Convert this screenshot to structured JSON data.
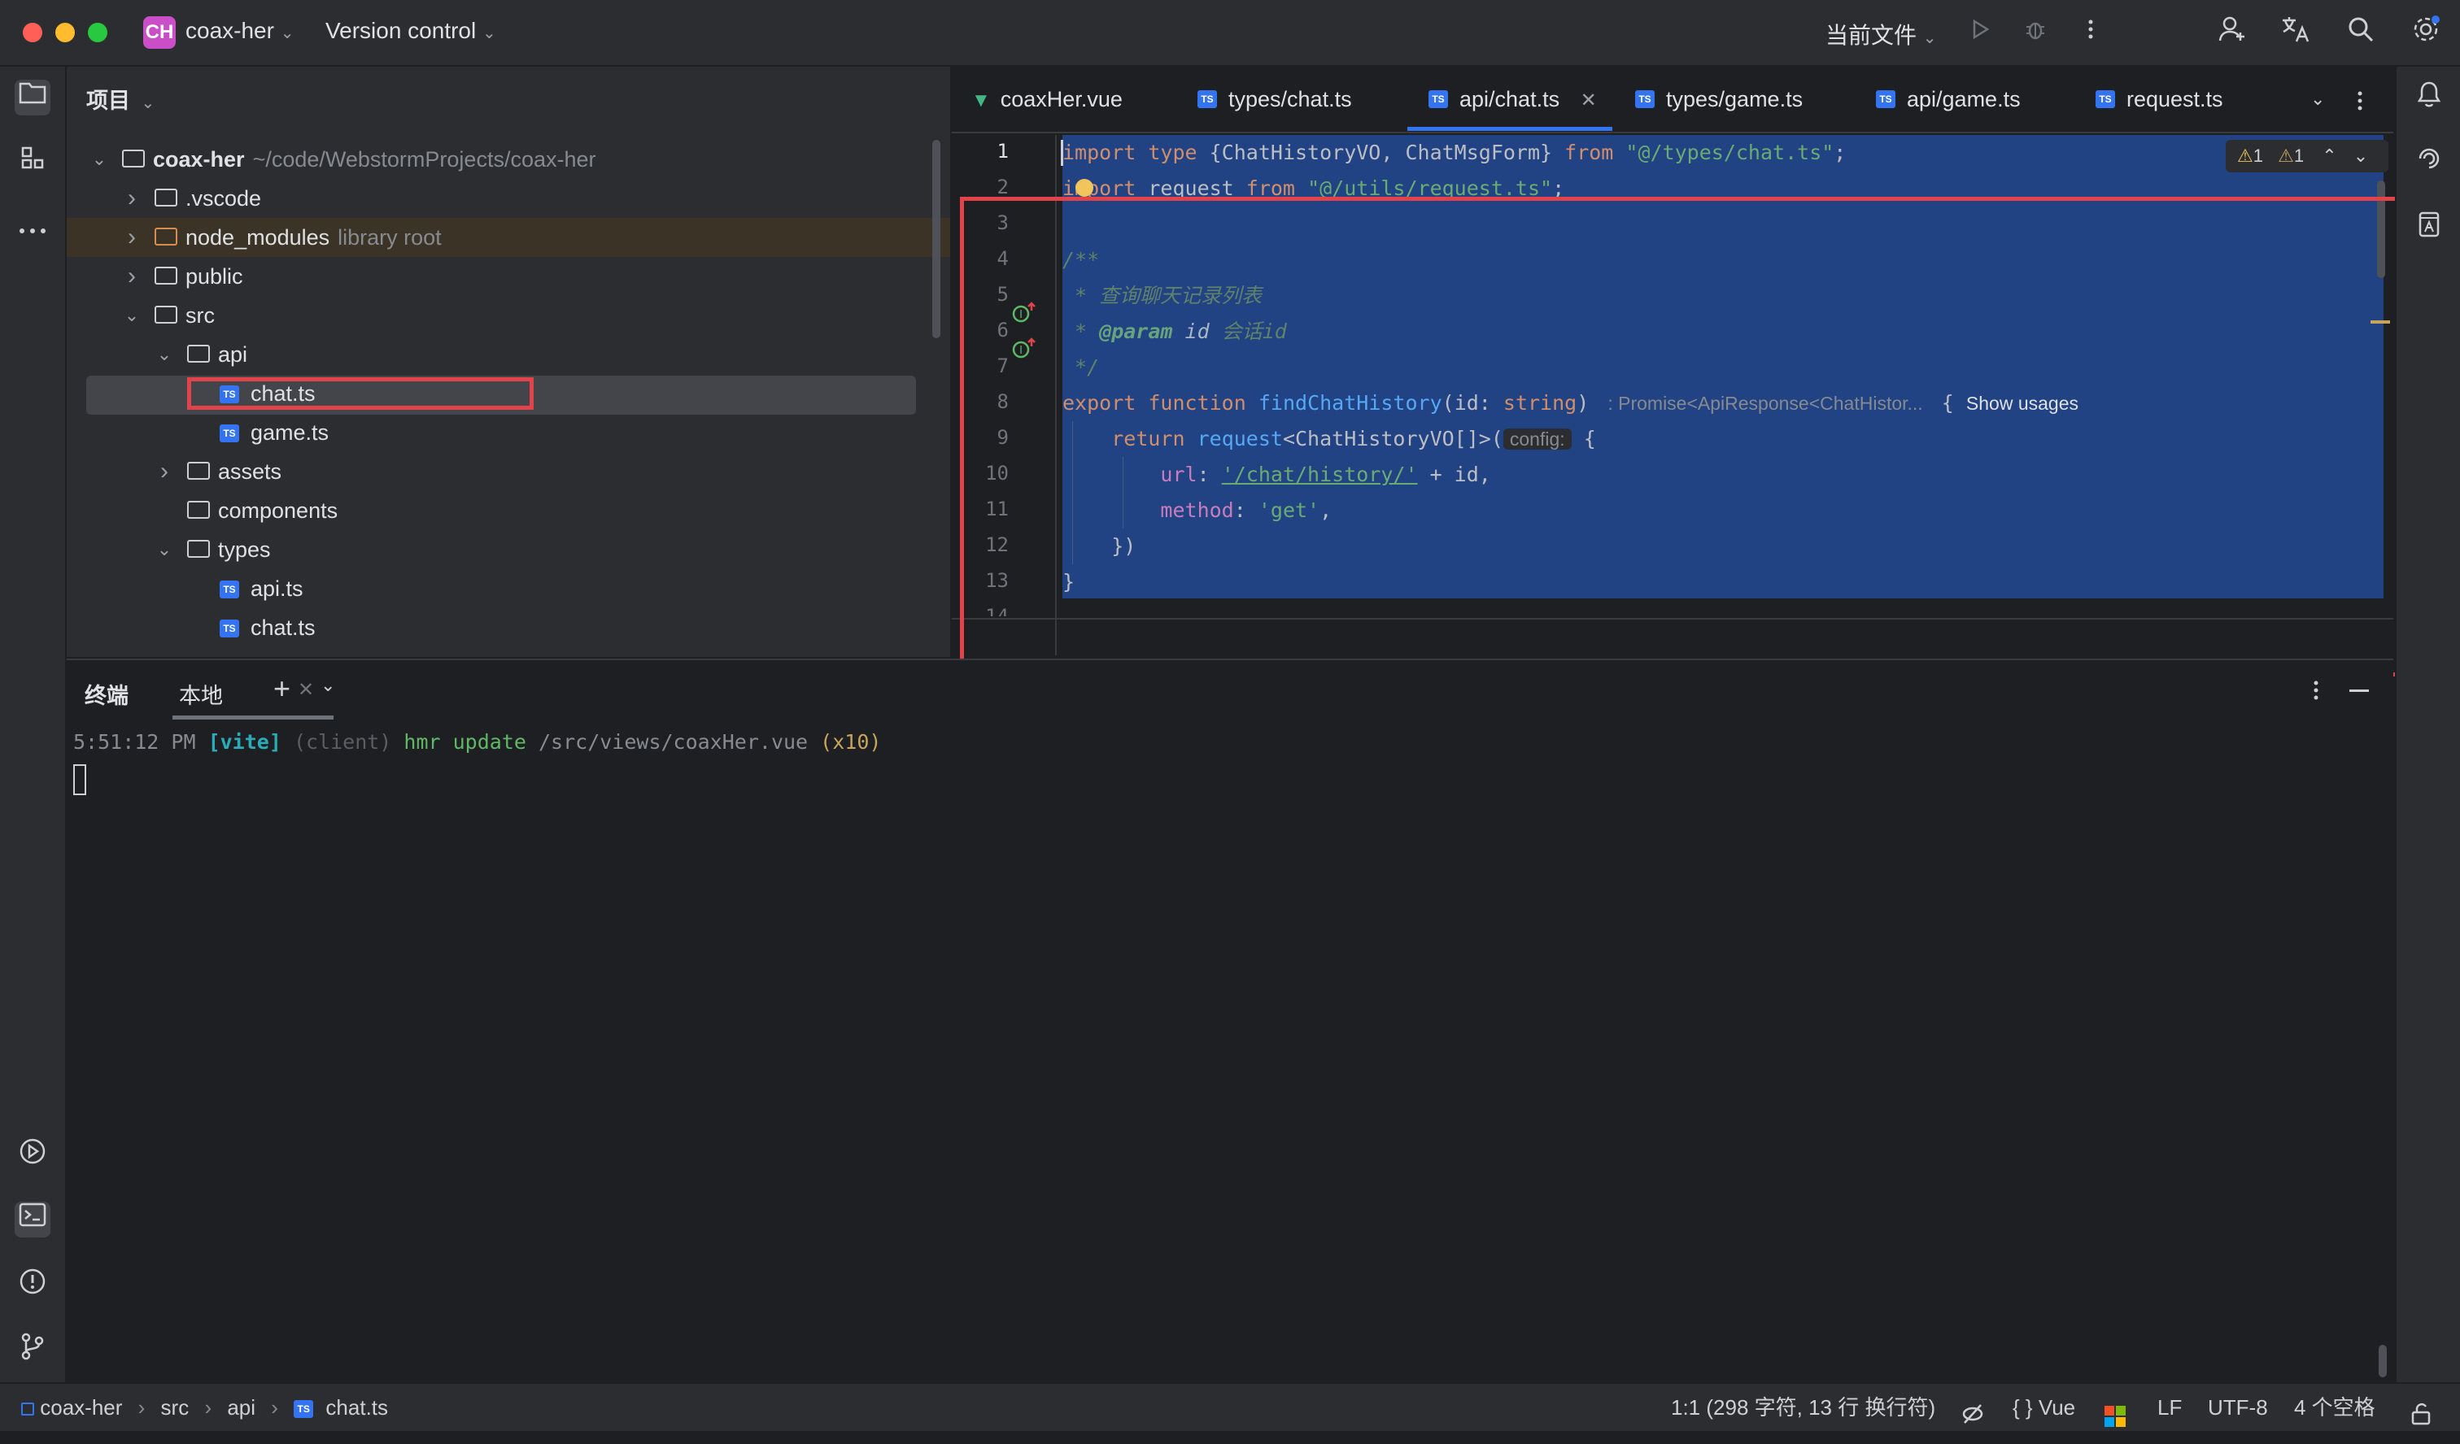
{
  "titlebar": {
    "project_badge": "CH",
    "project_name": "coax-her",
    "version_control": "Version control",
    "run_config": "当前文件",
    "icons": [
      "run-icon",
      "debug-icon",
      "more-icon",
      "add-user-icon",
      "translate-icon",
      "search-icon",
      "settings-icon"
    ]
  },
  "left_strip": {
    "icons": [
      "folder-icon",
      "structure-icon",
      "more-tools-icon",
      "services-icon",
      "terminal-icon",
      "problems-icon",
      "git-icon"
    ]
  },
  "project_panel": {
    "title": "项目",
    "tree": [
      {
        "name": "coax-her",
        "hint": "~/code/WebstormProjects/coax-her",
        "type": "folder",
        "expanded": true
      },
      {
        "name": ".vscode",
        "hint": "",
        "type": "folder",
        "expanded": false
      },
      {
        "name": "node_modules",
        "hint": "library root",
        "type": "folder",
        "expanded": false
      },
      {
        "name": "public",
        "hint": "",
        "type": "folder",
        "expanded": false
      },
      {
        "name": "src",
        "hint": "",
        "type": "folder",
        "expanded": true
      },
      {
        "name": "api",
        "hint": "",
        "type": "folder",
        "expanded": true
      },
      {
        "name": "chat.ts",
        "hint": "",
        "type": "ts",
        "selected": true
      },
      {
        "name": "game.ts",
        "hint": "",
        "type": "ts"
      },
      {
        "name": "assets",
        "hint": "",
        "type": "folder",
        "expanded": false
      },
      {
        "name": "components",
        "hint": "",
        "type": "folder"
      },
      {
        "name": "types",
        "hint": "",
        "type": "folder",
        "expanded": true
      },
      {
        "name": "api.ts",
        "hint": "",
        "type": "ts"
      },
      {
        "name": "chat.ts",
        "hint": "",
        "type": "ts"
      }
    ]
  },
  "editor": {
    "tabs": [
      {
        "label": "coaxHer.vue",
        "kind": "vue"
      },
      {
        "label": "types/chat.ts",
        "kind": "ts"
      },
      {
        "label": "api/chat.ts",
        "kind": "ts",
        "active": true
      },
      {
        "label": "types/game.ts",
        "kind": "ts"
      },
      {
        "label": "api/game.ts",
        "kind": "ts"
      },
      {
        "label": "request.ts",
        "kind": "ts"
      }
    ],
    "inspections": {
      "warnings_a": "1",
      "warnings_b": "1"
    },
    "line_numbers": [
      "1",
      "2",
      "3",
      "4",
      "5",
      "6",
      "7",
      "8",
      "9",
      "10",
      "11",
      "12",
      "13",
      "14"
    ],
    "code": {
      "l1": {
        "kw1": "import",
        "kw2": "type",
        "p1": " {ChatHistoryVO, ChatMsgForm} ",
        "kw3": "from",
        "s": "\"@/types/chat.ts\"",
        "end": ";"
      },
      "l2": {
        "kw1": "import",
        "p1": " request ",
        "kw2": "from",
        "s": "\"@/utils/request.ts\"",
        "end": ";"
      },
      "l4": "/**",
      "l5": " * 查询聊天记录列表",
      "l6_a": " * ",
      "l6_b": "@param",
      "l6_c": " id ",
      "l6_d": "会话id",
      "l7": " */",
      "l8": {
        "kw1": "export",
        "kw2": "function",
        "fn": "findChatHistory",
        "p1": "(id: ",
        "type": "string",
        "p2": ")",
        "inlay": ": Promise<ApiResponse<ChatHistor...",
        "brace": "{",
        "usages": "Show usages"
      },
      "l9": {
        "kw": "return",
        "fn": "request",
        "p1": "<ChatHistoryVO[]>(",
        "inlay": "config:",
        "p2": " {"
      },
      "l10": {
        "prop": "url",
        "p1": ": ",
        "s": "'/chat/history/'",
        "p2": " + id,"
      },
      "l11": {
        "prop": "method",
        "p1": ": ",
        "s": "'get'",
        "p2": ","
      },
      "l12": "})",
      "l13": "}"
    }
  },
  "terminal": {
    "title": "终端",
    "tab": "本地",
    "line": {
      "time": "5:51:12 PM ",
      "tag": "[vite]",
      "client": " (client) ",
      "msg": "hmr update ",
      "path": "/src/views/coaxHer.vue ",
      "count": "(x10)"
    }
  },
  "right_strip": {
    "icons": [
      "notifications-icon",
      "ai-assistant-icon",
      "database-icon"
    ]
  },
  "statusbar": {
    "breadcrumb": [
      "coax-her",
      "src",
      "api",
      "chat.ts"
    ],
    "position": "1:1 (298 字符, 13 行 换行符)",
    "language": "{ } Vue",
    "line_sep": "LF",
    "encoding": "UTF-8",
    "indent": "4 个空格"
  },
  "colors": {
    "selection": "#214283",
    "highlight_box": "#e2434b",
    "accent": "#3574f0"
  }
}
